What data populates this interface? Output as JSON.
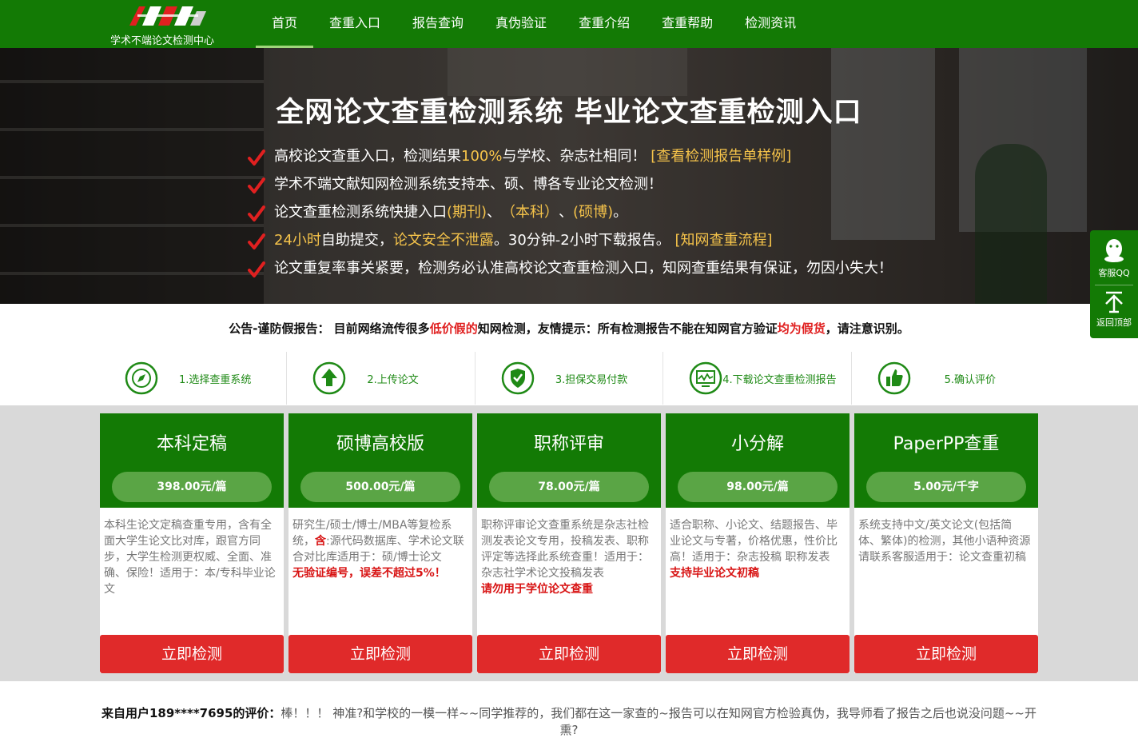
{
  "header": {
    "logo_text": "学术不端论文检测中心",
    "nav": [
      {
        "label": "首页",
        "active": true
      },
      {
        "label": "查重入口"
      },
      {
        "label": "报告查询"
      },
      {
        "label": "真伪验证"
      },
      {
        "label": "查重介绍"
      },
      {
        "label": "查重帮助"
      },
      {
        "label": "检测资讯"
      }
    ]
  },
  "hero": {
    "title": "全网论文查重检测系统 毕业论文查重检测入口",
    "features": {
      "f1": {
        "a": "高校论文查重入口，检测结果",
        "b": "100%",
        "c": "与学校、杂志社相同！",
        "link": "[查看检测报告单样例]"
      },
      "f2": {
        "a": "学术不端文献知网检测系统支持本、硕、博各专业论文检测！"
      },
      "f3": {
        "a": "论文查重检测系统快捷入口",
        "b": "(期刊)",
        "c": "、",
        "d": "（本科）",
        "e": "、",
        "f": "(硕博)",
        "g": "。"
      },
      "f4": {
        "a": "24小时",
        "b": "自助提交，",
        "c": "论文安全不泄露",
        "d": "。30分钟-2小时下载报告。",
        "link": "[知网查重流程]"
      },
      "f5": {
        "a": "论文重复率事关紧要，检测务必认准高校论文查重检测入口，知网查重结果有保证，勿因小失大！"
      }
    }
  },
  "notice": {
    "a": "公告-谨防假报告：  目前网络流传很多",
    "b": "低价假的",
    "c": "知网检测，友情提示：所有检测报告不能在知网官方验证",
    "d": "均为假货",
    "e": "，请注意识别。"
  },
  "steps": [
    {
      "label": "1.选择查重系统",
      "icon": "compass-icon"
    },
    {
      "label": "2.上传论文",
      "icon": "upload-arrow-icon"
    },
    {
      "label": "3.担保交易付款",
      "icon": "shield-check-icon"
    },
    {
      "label": "4.下载论文查重检测报告",
      "icon": "report-monitor-icon"
    },
    {
      "label": "5.确认评价",
      "icon": "thumbs-up-icon"
    }
  ],
  "packages": [
    {
      "name": "本科定稿",
      "price": "398.00元/篇",
      "desc": "本科生论文定稿查重专用，含有全面大学生论文比对库，跟官方同步，大学生检测更权威、全面、准确、保险！适用于：本/专科毕业论文",
      "warn": "",
      "button": "立即检测"
    },
    {
      "name": "硕博高校版",
      "price": "500.00元/篇",
      "desc_a": "研究生/硕士/博士/MBA等复检系统，",
      "desc_b": "含",
      "desc_c": ":源代码数据库、学术论文联合对比库适用于：硕/博士论文",
      "warn": "无验证编号，误差不超过5%！",
      "button": "立即检测"
    },
    {
      "name": "职称评审",
      "price": "78.00元/篇",
      "desc": "职称评审论文查重系统是杂志社检测发表论文专用，投稿发表、职称评定等选择此系统查重！适用于：杂志社学术论文投稿发表",
      "warn": "请勿用于学位论文查重",
      "button": "立即检测"
    },
    {
      "name": "小分解",
      "price": "98.00元/篇",
      "desc": "适合职称、小论文、结题报告、毕业论文与专著，价格优惠，性价比高！适用于：杂志投稿 职称发表",
      "warn": "支持毕业论文初稿",
      "button": "立即检测"
    },
    {
      "name": "PaperPP查重",
      "price": "5.00元/千字",
      "desc": "系统支持中文/英文论文(包括简体、繁体)的检测，其他小语种资源请联系客服适用于：论文查重初稿",
      "warn": "",
      "button": "立即检测"
    }
  ],
  "review": {
    "user": "来自用户189****7695的评价：",
    "text": "棒！！！ 神准?和学校的一模一样~~同学推荐的，我们都在这一家查的~报告可以在知网官方检验真伪，我导师看了报告之后也说没问题~~开熏?"
  },
  "side": {
    "qq": "客服QQ",
    "top": "返回顶部"
  },
  "colors": {
    "brand_green": "#137a05",
    "price_pill": "#5aa545",
    "button_red": "#e02a2a",
    "highlight_yellow": "#f5c34a",
    "warn_red": "#d81414"
  }
}
